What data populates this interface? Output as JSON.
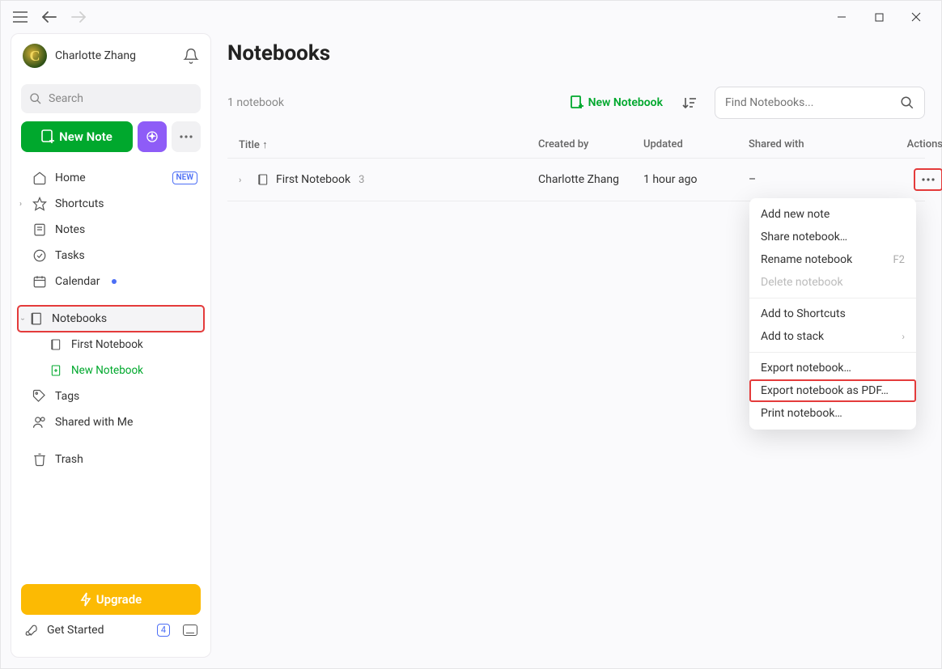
{
  "user": {
    "name": "Charlotte Zhang",
    "avatar_letter": "C"
  },
  "sidebar": {
    "search_placeholder": "Search",
    "new_note_label": "New Note",
    "items": {
      "home": {
        "label": "Home",
        "badge": "NEW"
      },
      "shortcuts": {
        "label": "Shortcuts"
      },
      "notes": {
        "label": "Notes"
      },
      "tasks": {
        "label": "Tasks"
      },
      "calendar": {
        "label": "Calendar"
      },
      "notebooks": {
        "label": "Notebooks"
      },
      "first_nb": {
        "label": "First Notebook"
      },
      "new_nb": {
        "label": "New Notebook"
      },
      "tags": {
        "label": "Tags"
      },
      "shared": {
        "label": "Shared with Me"
      },
      "trash": {
        "label": "Trash"
      }
    },
    "upgrade_label": "Upgrade",
    "getstarted_label": "Get Started",
    "getstarted_count": "4"
  },
  "main": {
    "title": "Notebooks",
    "count_label": "1 notebook",
    "new_notebook_label": "New Notebook",
    "search_placeholder": "Find Notebooks...",
    "columns": {
      "title": "Title ↑",
      "created_by": "Created by",
      "updated": "Updated",
      "shared_with": "Shared with",
      "actions": "Actions"
    },
    "row": {
      "name": "First Notebook",
      "note_count": "3",
      "created_by": "Charlotte Zhang",
      "updated": "1 hour ago",
      "shared_with": "–"
    }
  },
  "context_menu": {
    "add_note": "Add new note",
    "share": "Share notebook…",
    "rename": "Rename notebook",
    "rename_sc": "F2",
    "delete": "Delete notebook",
    "add_shortcut": "Add to Shortcuts",
    "add_stack": "Add to stack",
    "export": "Export notebook…",
    "export_pdf": "Export notebook as PDF…",
    "print": "Print notebook…"
  }
}
